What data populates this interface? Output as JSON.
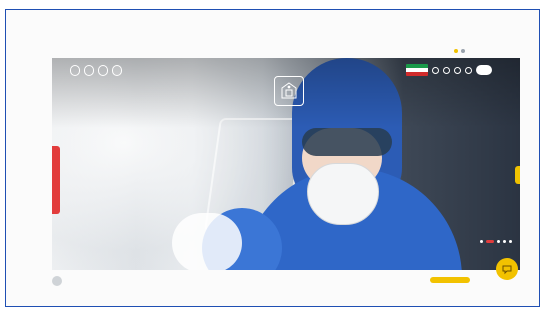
{
  "page": {
    "frame_border_color": "#1f4fb3",
    "accent": {
      "yellow": "#f2c200",
      "red": "#e23c3c",
      "blue": "#2f67c8"
    }
  },
  "topstrip": {
    "text": "",
    "icon": "language-icon"
  },
  "header": {
    "quick_links": [
      {
        "label": ""
      },
      {
        "label": ""
      },
      {
        "label": ""
      },
      {
        "label": ""
      }
    ],
    "search_button_label": "",
    "logo_subtitle": "",
    "menu_left": [
      "",
      "",
      "",
      "",
      ""
    ],
    "menu_right": [
      "",
      "",
      ""
    ]
  },
  "hero": {
    "image_description": "",
    "slider_active_index": 1,
    "slider_count": 5
  },
  "bottom": {
    "left_text": "",
    "right_chip": ""
  },
  "icons": {
    "flag": "iran-flag-icon",
    "social1": "instagram-icon",
    "social2": "telegram-icon",
    "social3": "globe-icon",
    "search": "search-icon",
    "chat": "chat-icon"
  }
}
